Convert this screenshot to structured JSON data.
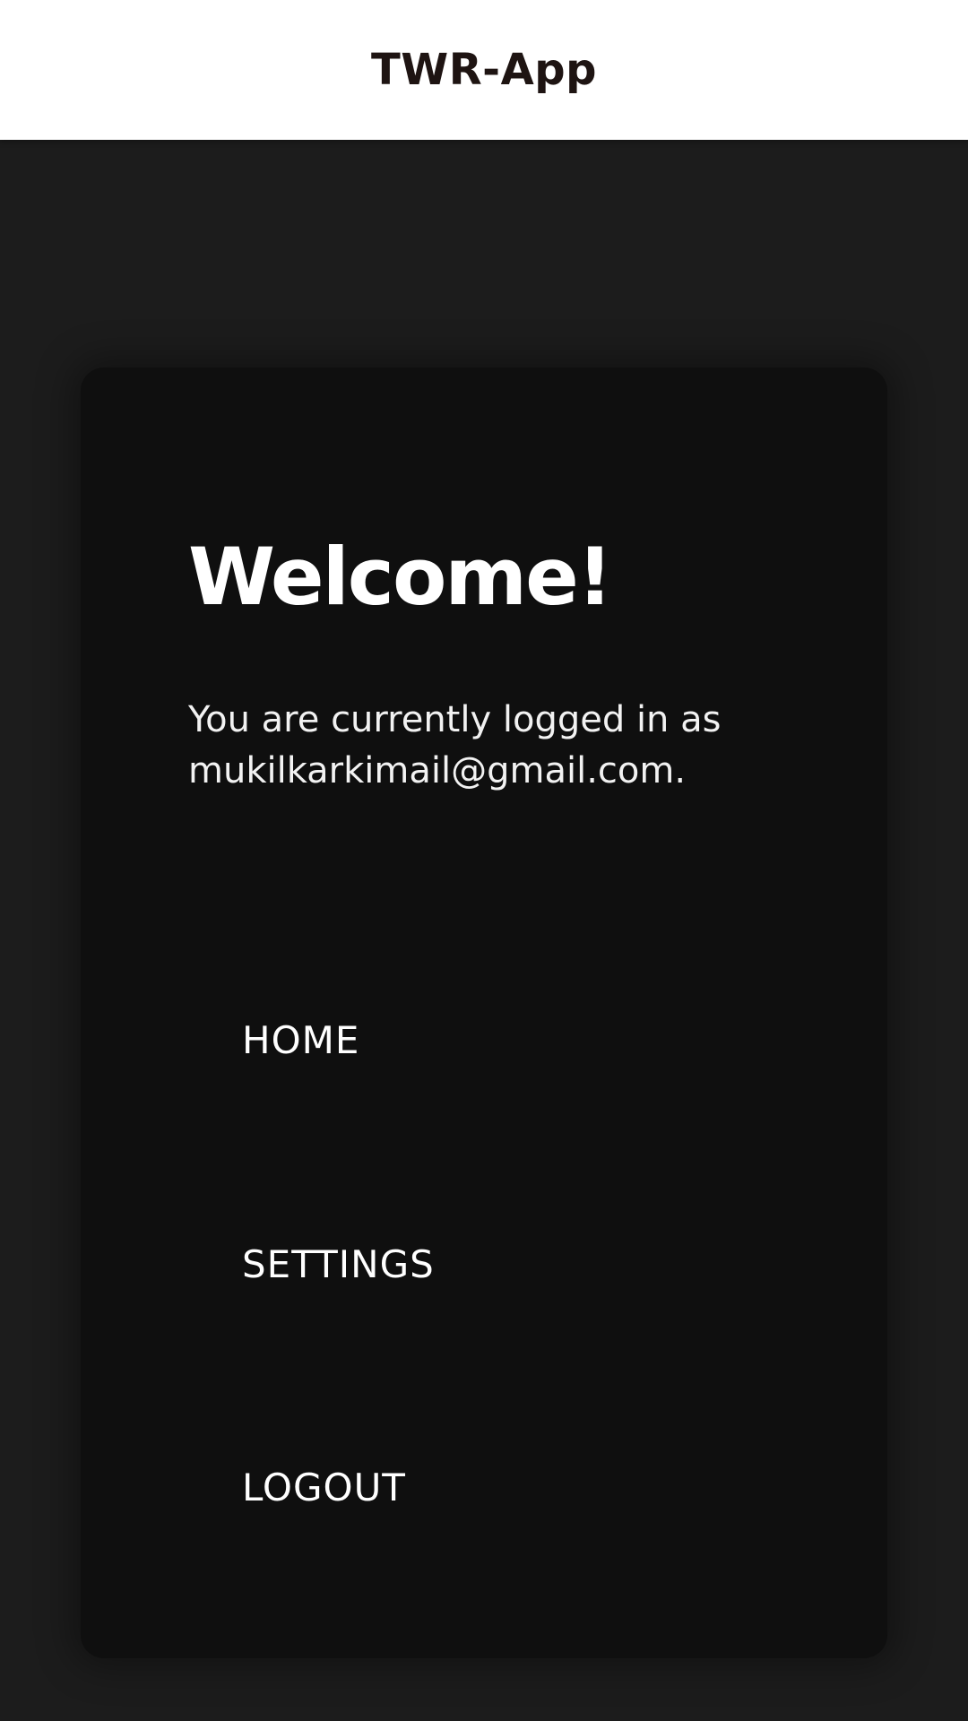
{
  "app_bar": {
    "title": "TWR-App"
  },
  "card": {
    "title": "Welcome!",
    "login_prefix": "You are currently logged in as",
    "email": "mukilkarkimail@gmail.com."
  },
  "nav": {
    "items": [
      {
        "label": "HOME"
      },
      {
        "label": "SETTINGS"
      },
      {
        "label": "LOGOUT"
      }
    ]
  },
  "colors": {
    "background": "#1c1c1c",
    "card": "#0f0f0f",
    "app_bar": "#ffffff",
    "title_text": "#1e1412",
    "text": "#ffffff"
  }
}
